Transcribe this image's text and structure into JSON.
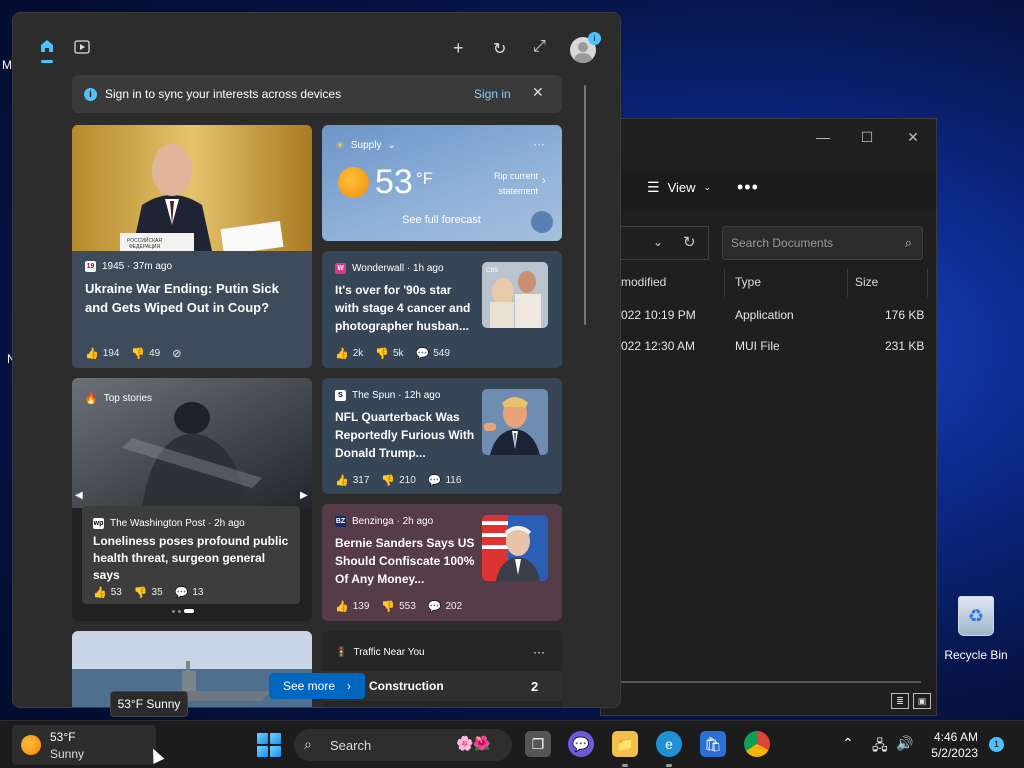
{
  "desktop": {
    "label_m": "M",
    "label_n": "N",
    "recycle_bin": "Recycle Bin"
  },
  "explorer": {
    "view_label": "View",
    "more_label": "•••",
    "search_placeholder": "Search Documents",
    "columns": [
      "modified",
      "Type",
      "Size"
    ],
    "rows": [
      {
        "date": "022 10:19 PM",
        "type": "Application",
        "size": "176 KB"
      },
      {
        "date": "022 12:30 AM",
        "type": "MUI File",
        "size": "231 KB"
      }
    ]
  },
  "widgets": {
    "signin_text": "Sign in to sync your interests across devices",
    "signin_link": "Sign in",
    "avatar_badge": "i",
    "weather": {
      "location": "Supply",
      "temp": "53",
      "unit": "°F",
      "alert_line1": "Rip current",
      "alert_line2": "statement",
      "forecast_link": "See full forecast",
      "more": "···"
    },
    "cards": {
      "putin": {
        "source": "1945 · 37m ago",
        "headline": "Ukraine War Ending: Putin Sick and Gets Wiped Out in Coup?",
        "likes": "194",
        "dislikes": "49",
        "caption_line1": "РОССИЙСКАЯ",
        "caption_line2": "ФЕДЕРАЦИЯ"
      },
      "wonderwall": {
        "source": "Wonderwall · 1h ago",
        "headline": "It's over for '90s star with stage 4 cancer and photographer husban...",
        "likes": "2k",
        "dislikes": "5k",
        "comments": "549",
        "thumb_tag": "CBS"
      },
      "top_stories": {
        "label": "Top stories",
        "source": "The Washington Post · 2h ago",
        "headline": "Loneliness poses profound public health threat, surgeon general says",
        "likes": "53",
        "dislikes": "35",
        "comments": "13"
      },
      "spun": {
        "source": "The Spun · 12h ago",
        "headline": "NFL Quarterback Was Reportedly Furious With Donald Trump...",
        "likes": "317",
        "dislikes": "210",
        "comments": "116"
      },
      "benzinga": {
        "source": "Benzinga · 2h ago",
        "headline": "Bernie Sanders Says US Should Confiscate 100% Of Any Money...",
        "likes": "139",
        "dislikes": "553",
        "comments": "202"
      },
      "traffic": {
        "label": "Traffic Near You",
        "item": "Construction",
        "count": "2",
        "more": "···"
      }
    },
    "see_more": "See more"
  },
  "tooltip": "53°F Sunny",
  "taskbar": {
    "weather_temp": "53°F",
    "weather_cond": "Sunny",
    "search_label": "Search",
    "time": "4:46 AM",
    "date": "5/2/2023",
    "notif_count": "1"
  },
  "colors": {
    "accent": "#4cc2ff",
    "button": "#0067c0",
    "panel": "#2c2c2c"
  }
}
